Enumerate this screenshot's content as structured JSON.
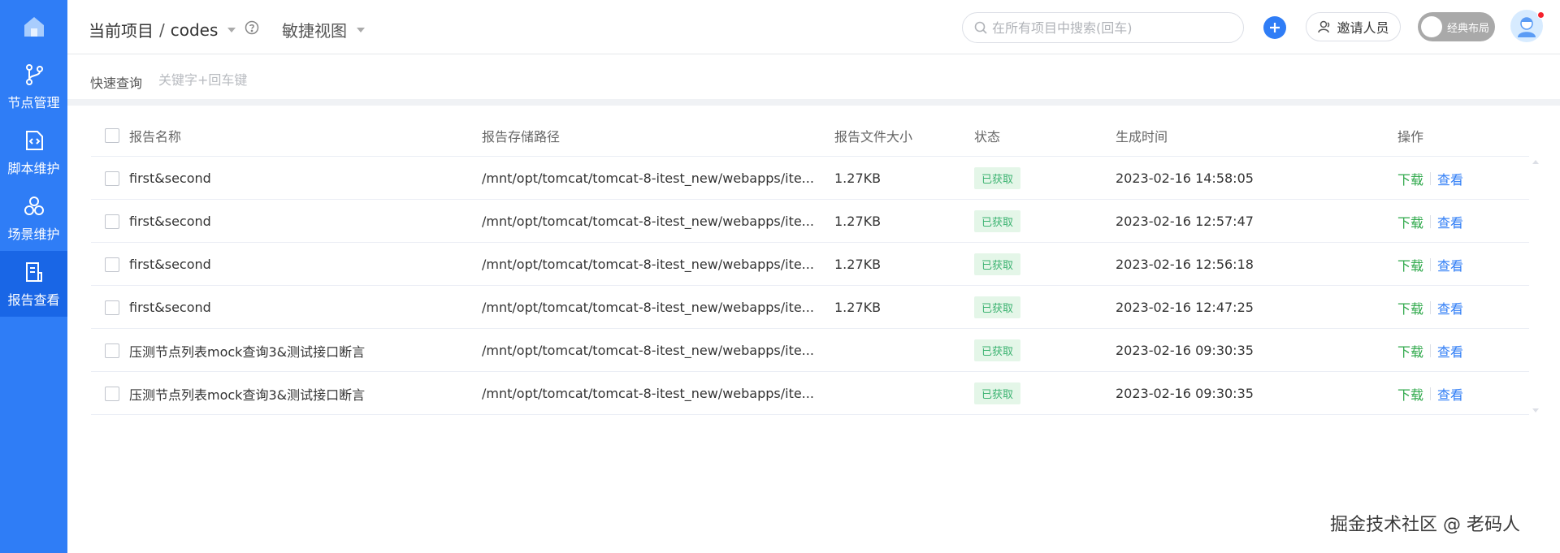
{
  "sidebar": {
    "items": [
      {
        "label": "节点管理",
        "icon": "branch-icon"
      },
      {
        "label": "脚本维护",
        "icon": "code-file-icon"
      },
      {
        "label": "场景维护",
        "icon": "cluster-icon"
      },
      {
        "label": "报告查看",
        "icon": "report-icon"
      }
    ]
  },
  "header": {
    "project_label": "当前项目",
    "project_sep": "/",
    "project_name": "codes",
    "view_label": "敏捷视图",
    "search_placeholder": "在所有项目中搜索(回车)",
    "invite_label": "邀请人员",
    "layout_toggle_label": "经典布局"
  },
  "quick_search": {
    "label": "快速查询",
    "placeholder": "关键字+回车键"
  },
  "table": {
    "columns": {
      "name": "报告名称",
      "path": "报告存储路径",
      "size": "报告文件大小",
      "status": "状态",
      "time": "生成时间",
      "ops": "操作"
    },
    "rows": [
      {
        "name": "first&second",
        "path": "/mnt/opt/tomcat/tomcat-8-itest_new/webapps/ite...",
        "size": "1.27KB",
        "status": "已获取",
        "time": "2023-02-16 14:58:05",
        "download": "下载",
        "view": "查看"
      },
      {
        "name": "first&second",
        "path": "/mnt/opt/tomcat/tomcat-8-itest_new/webapps/ite...",
        "size": "1.27KB",
        "status": "已获取",
        "time": "2023-02-16 12:57:47",
        "download": "下载",
        "view": "查看"
      },
      {
        "name": "first&second",
        "path": "/mnt/opt/tomcat/tomcat-8-itest_new/webapps/ite...",
        "size": "1.27KB",
        "status": "已获取",
        "time": "2023-02-16 12:56:18",
        "download": "下载",
        "view": "查看"
      },
      {
        "name": "first&second",
        "path": "/mnt/opt/tomcat/tomcat-8-itest_new/webapps/ite...",
        "size": "1.27KB",
        "status": "已获取",
        "time": "2023-02-16 12:47:25",
        "download": "下载",
        "view": "查看"
      },
      {
        "name": "压测节点列表mock查询3&测试接口断言",
        "path": "/mnt/opt/tomcat/tomcat-8-itest_new/webapps/ite...",
        "size": "",
        "status": "已获取",
        "time": "2023-02-16 09:30:35",
        "download": "下载",
        "view": "查看"
      },
      {
        "name": "压测节点列表mock查询3&测试接口断言",
        "path": "/mnt/opt/tomcat/tomcat-8-itest_new/webapps/ite...",
        "size": "",
        "status": "已获取",
        "time": "2023-02-16 09:30:35",
        "download": "下载",
        "view": "查看"
      }
    ]
  },
  "watermark": "掘金技术社区 @ 老码人",
  "colors": {
    "sidebar": "#2f7df6",
    "sidebar_active": "#1966e6",
    "download": "#2ea84a",
    "view": "#2f7df6",
    "badge_bg": "#e4f6e8",
    "badge_text": "#3cb371"
  }
}
